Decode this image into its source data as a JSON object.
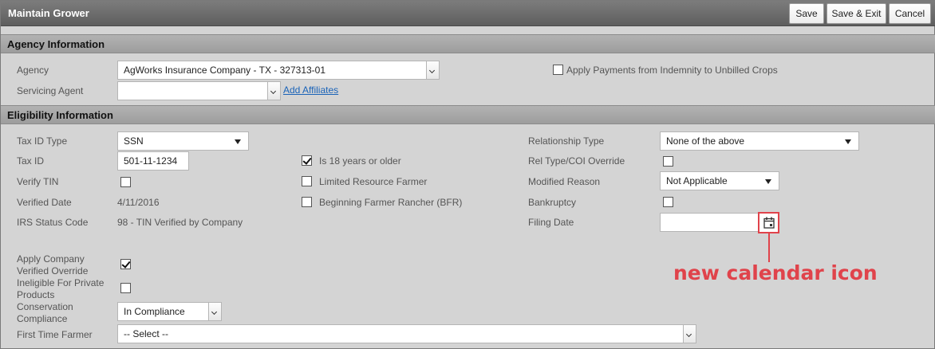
{
  "window": {
    "title": "Maintain Grower",
    "buttons": {
      "save": "Save",
      "save_exit": "Save & Exit",
      "cancel": "Cancel"
    }
  },
  "agency": {
    "header": "Agency Information",
    "agency_label": "Agency",
    "agency_value": "AgWorks Insurance Company - TX - 327313-01",
    "servicing_agent_label": "Servicing Agent",
    "servicing_agent_value": "",
    "add_affiliates": "Add Affiliates",
    "apply_payments_label": "Apply Payments from Indemnity to Unbilled Crops",
    "apply_payments_checked": false
  },
  "eligibility": {
    "header": "Eligibility Information",
    "tax_id_type_label": "Tax ID Type",
    "tax_id_type_value": "SSN",
    "tax_id_label": "Tax ID",
    "tax_id_value": "501-11-1234",
    "verify_tin_label": "Verify TIN",
    "verify_tin_checked": false,
    "verified_date_label": "Verified Date",
    "verified_date_value": "4/11/2016",
    "irs_status_label": "IRS Status Code",
    "irs_status_value": "98 - TIN Verified by Company",
    "is18_label": "Is 18 years or older",
    "is18_checked": true,
    "limited_resource_label": "Limited Resource Farmer",
    "limited_resource_checked": false,
    "beginning_farmer_label": "Beginning Farmer Rancher (BFR)",
    "beginning_farmer_checked": false,
    "relationship_type_label": "Relationship Type",
    "relationship_type_value": "None of the above",
    "rel_type_override_label": "Rel Type/COI Override",
    "rel_type_override_checked": false,
    "modified_reason_label": "Modified Reason",
    "modified_reason_value": "Not Applicable",
    "bankruptcy_label": "Bankruptcy",
    "bankruptcy_checked": false,
    "filing_date_label": "Filing Date",
    "filing_date_value": "",
    "apply_company_override_label": "Apply Company Verified Override",
    "apply_company_override_checked": true,
    "ineligible_private_label": "Ineligible For Private Products",
    "ineligible_private_checked": false,
    "conservation_label": "Conservation Compliance",
    "conservation_value": "In Compliance",
    "first_time_farmer_label": "First Time Farmer",
    "first_time_farmer_value": "-- Select --"
  },
  "annotation": {
    "text": "new calendar icon",
    "color": "#e0434b"
  },
  "icons": {
    "calendar": "calendar-icon",
    "dropdown": "chevron-down-icon"
  }
}
